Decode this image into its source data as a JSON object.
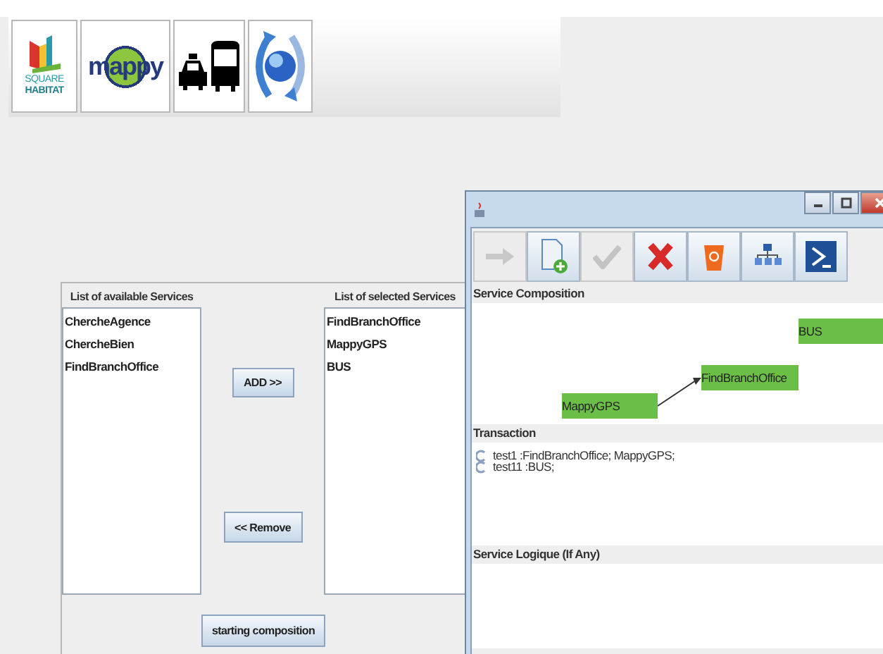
{
  "banner": {
    "logos": [
      {
        "kind": "square_habitat",
        "lines": [
          "SQUARE",
          "HABITAT"
        ]
      },
      {
        "kind": "mappy",
        "text": "mappy"
      },
      {
        "kind": "transport"
      },
      {
        "kind": "globe_sync"
      }
    ]
  },
  "available": {
    "label": "List of available Services",
    "items": [
      "ChercheAgence",
      "ChercheBien",
      "FindBranchOffice"
    ]
  },
  "selected": {
    "label": "List of selected Services",
    "items": [
      "FindBranchOffice",
      "MappyGPS",
      "BUS"
    ]
  },
  "buttons": {
    "add": "ADD >>",
    "remove": "<< Remove",
    "start": "starting composition"
  },
  "window": {
    "toolbar": [
      {
        "kind": "arrow",
        "disabled": true
      },
      {
        "kind": "new_document",
        "disabled": false
      },
      {
        "kind": "check",
        "disabled": true
      },
      {
        "kind": "delete",
        "disabled": false
      },
      {
        "kind": "trash",
        "disabled": false
      },
      {
        "kind": "network",
        "disabled": false
      },
      {
        "kind": "console",
        "disabled": false
      }
    ],
    "composition": {
      "title": "Service Composition",
      "nodes": [
        {
          "label": "BUS"
        },
        {
          "label": "FindBranchOffice",
          "arrow_to_previous": false
        },
        {
          "label": "MappyGPS",
          "arrow_to_previous": true
        }
      ]
    },
    "transaction": {
      "title": "Transaction",
      "items": [
        "test1 :FindBranchOffice; MappyGPS;",
        "test11 :BUS;"
      ]
    },
    "logic": {
      "title": "Service Logique (If Any)"
    }
  }
}
